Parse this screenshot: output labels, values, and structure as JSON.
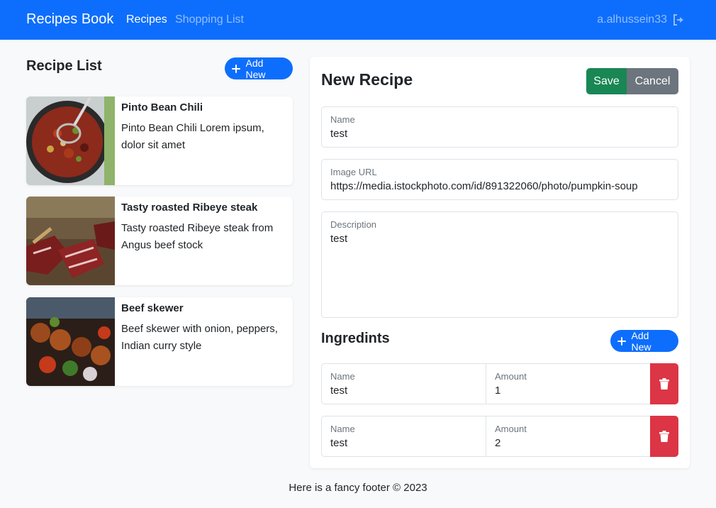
{
  "navbar": {
    "brand": "Recipes Book",
    "links": [
      "Recipes",
      "Shopping List"
    ],
    "user": "a.alhussein33",
    "colors": {
      "primary": "#0d6efd"
    }
  },
  "recipe_list": {
    "title": "Recipe List",
    "add_label": "Add New",
    "items": [
      {
        "name": "Pinto Bean Chili",
        "description": "Pinto Bean Chili Lorem ipsum, dolor sit amet"
      },
      {
        "name": "Tasty roasted Ribeye steak",
        "description": "Tasty roasted Ribeye steak from Angus beef stock"
      },
      {
        "name": "Beef skewer",
        "description": "Beef skewer with onion, peppers, Indian curry style"
      }
    ]
  },
  "form": {
    "title": "New Recipe",
    "save_label": "Save",
    "cancel_label": "Cancel",
    "name": {
      "label": "Name",
      "value": "test"
    },
    "image_url": {
      "label": "Image URL",
      "value": "https://media.istockphoto.com/id/891322060/photo/pumpkin-soup"
    },
    "description": {
      "label": "Description",
      "value": "test"
    },
    "ingredients": {
      "title": "Ingredints",
      "add_label": "Add New",
      "rows": [
        {
          "name_label": "Name",
          "name": "test",
          "amount_label": "Amount",
          "amount": "1"
        },
        {
          "name_label": "Name",
          "name": "test",
          "amount_label": "Amount",
          "amount": "2"
        }
      ]
    }
  },
  "footer": {
    "text": "Here is a fancy footer © 2023"
  }
}
